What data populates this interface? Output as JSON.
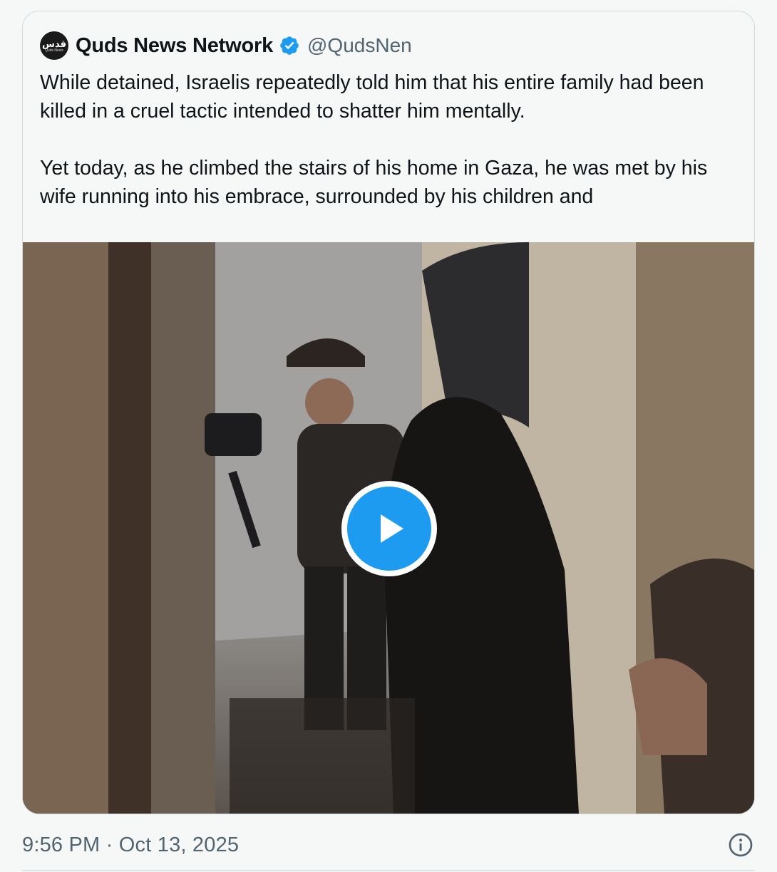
{
  "tweet": {
    "author": {
      "name": "Quds News Network",
      "handle": "@QudsNen",
      "avatar_text": "قدس",
      "avatar_subtext": "Quds News",
      "verified": true
    },
    "text": "While detained, Israelis repeatedly told him that his entire family had been killed in a cruel tactic intended to shatter him mentally.\n\nYet today, as he climbed the stairs of his home in Gaza, he was met by his wife running into his embrace, surrounded by his children and",
    "media": {
      "type": "video",
      "play_icon": "play-icon"
    },
    "timestamp": "9:56 PM · Oct 13, 2025",
    "info_icon": "info-icon"
  },
  "colors": {
    "accent": "#1d9bf0",
    "text_primary": "#0f1419",
    "text_secondary": "#536471",
    "border": "#cfd9de",
    "background": "#f6f8f8"
  }
}
